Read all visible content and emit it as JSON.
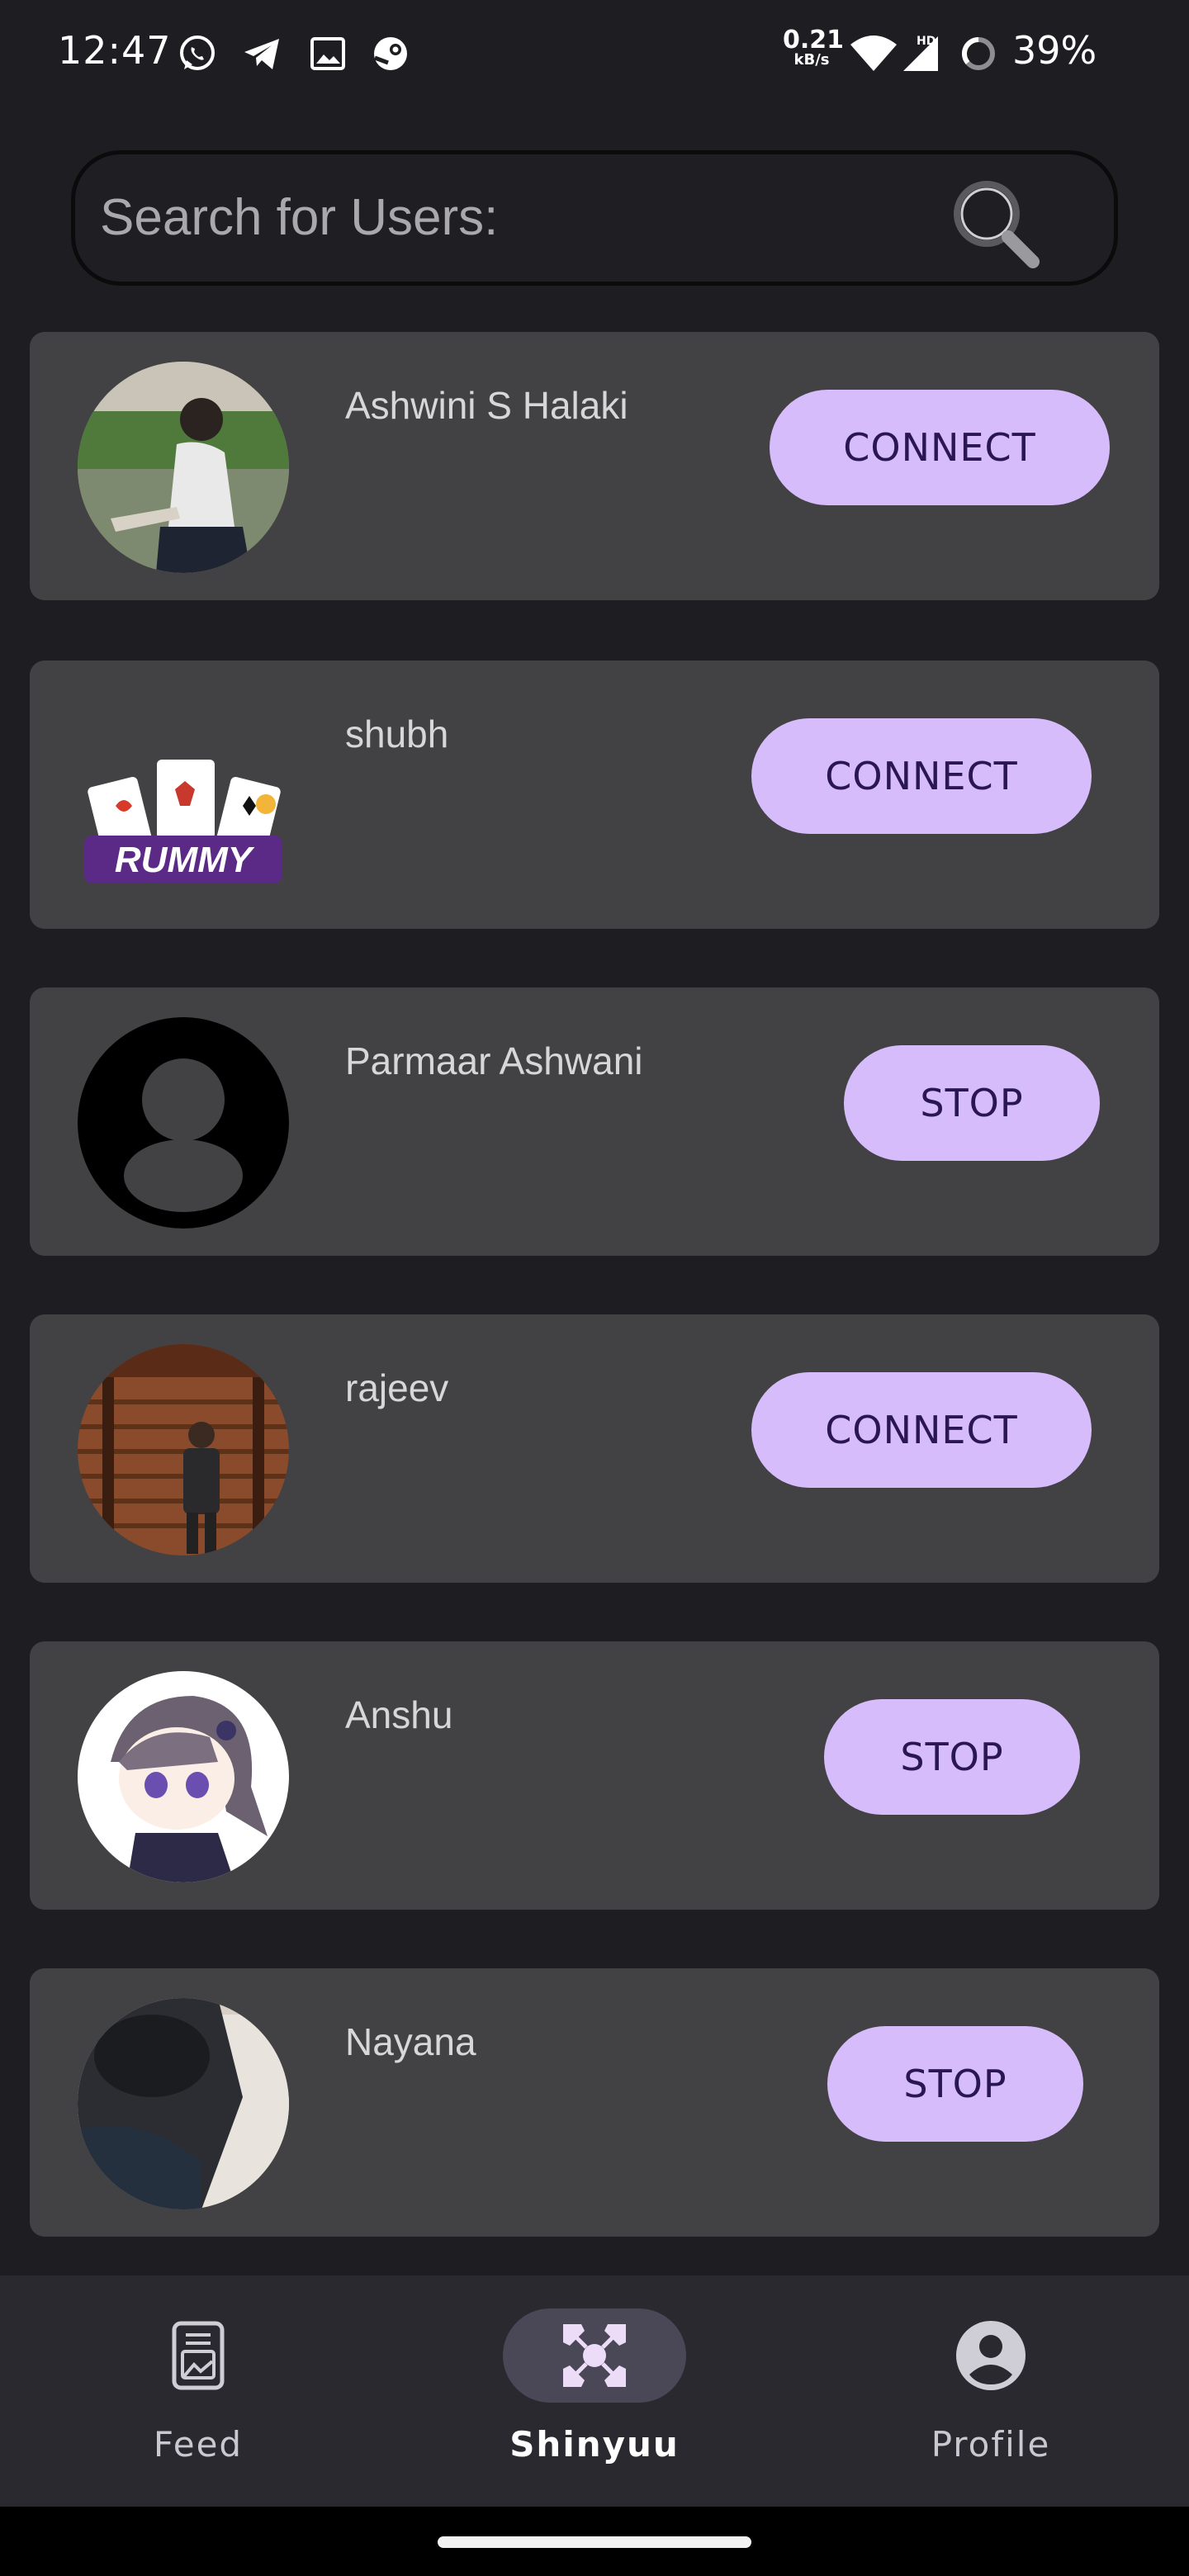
{
  "status_bar": {
    "time": "12:47",
    "net_speed_value": "0.21",
    "net_speed_unit": "kB/s",
    "network_label": "HD",
    "battery": "39%",
    "icons": [
      "whatsapp-icon",
      "telegram-icon",
      "gallery-icon",
      "steam-icon",
      "wifi-icon",
      "signal-icon",
      "battery-saver-icon"
    ]
  },
  "search": {
    "placeholder": "Search for Users:",
    "value": ""
  },
  "users": [
    {
      "name": "Ashwini S Halaki",
      "action": "CONNECT",
      "avatar": "photo-woman"
    },
    {
      "name": "shubh",
      "action": "CONNECT",
      "avatar": "rummy-logo"
    },
    {
      "name": "Parmaar Ashwani",
      "action": "STOP",
      "avatar": "default-profile"
    },
    {
      "name": "rajeev",
      "action": "CONNECT",
      "avatar": "photo-man"
    },
    {
      "name": "Anshu",
      "action": "STOP",
      "avatar": "anime-character"
    },
    {
      "name": "Nayana",
      "action": "STOP",
      "avatar": "photo-dark"
    }
  ],
  "bottom_nav": {
    "items": [
      {
        "label": "Feed",
        "icon": "feed-icon",
        "active": false
      },
      {
        "label": "Shinyuu",
        "icon": "shinyuu-icon",
        "active": true
      },
      {
        "label": "Profile",
        "icon": "profile-icon",
        "active": false
      }
    ]
  },
  "colors": {
    "background": "#1e1d22",
    "card": "#424244",
    "accent_button": "#d6bcfa",
    "button_text": "#2b1654",
    "nav_background": "#2a2930"
  }
}
